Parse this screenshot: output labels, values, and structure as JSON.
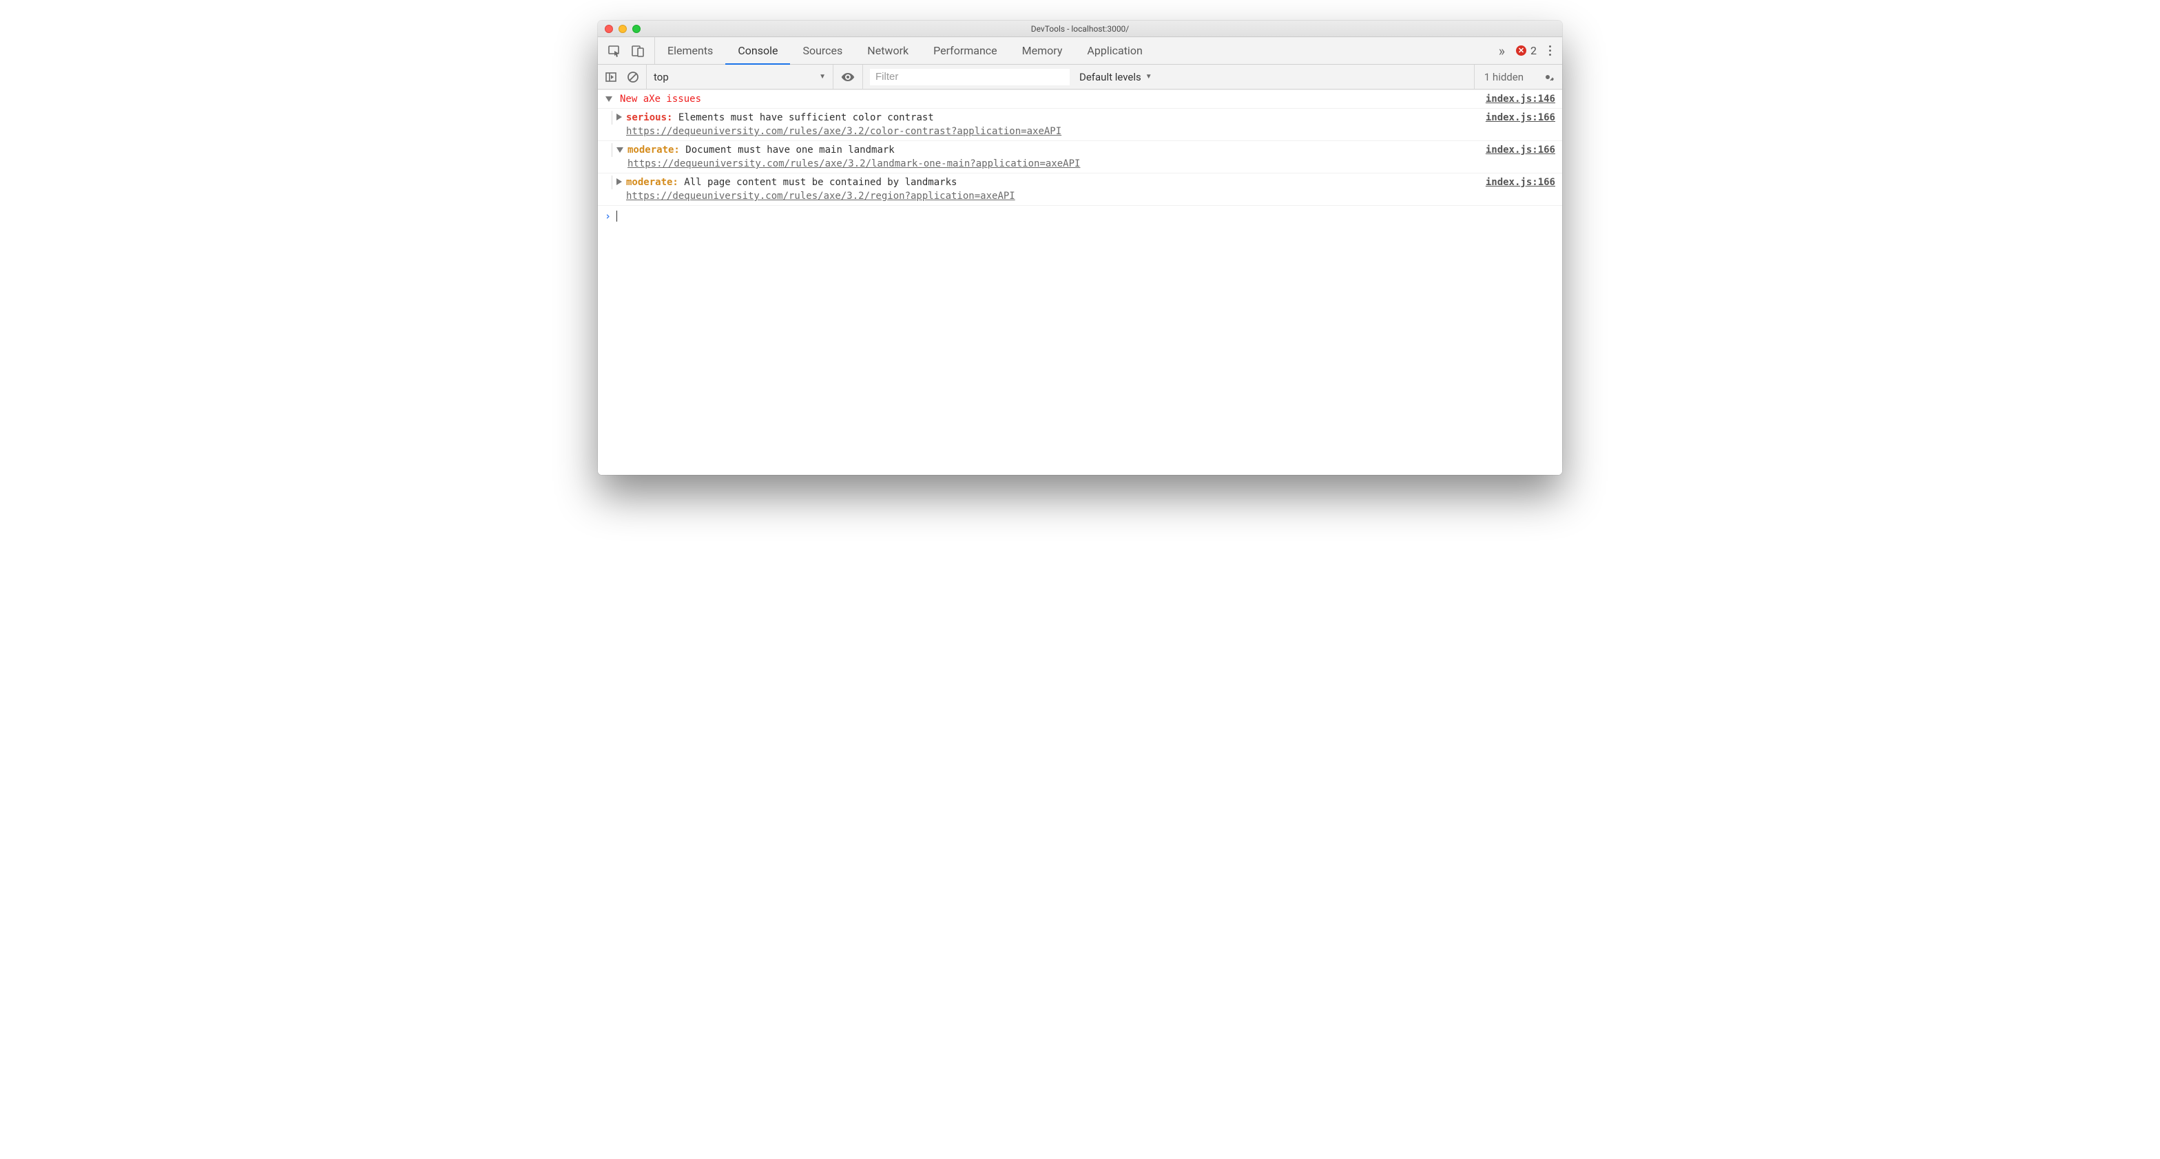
{
  "window": {
    "title": "DevTools - localhost:3000/"
  },
  "tabs": {
    "items": [
      "Elements",
      "Console",
      "Sources",
      "Network",
      "Performance",
      "Memory",
      "Application"
    ],
    "active_index": 1,
    "error_count": "2"
  },
  "console_bar": {
    "context": "top",
    "filter_placeholder": "Filter",
    "levels_label": "Default levels",
    "hidden_label": "1 hidden"
  },
  "console": {
    "group": {
      "title": "New aXe issues",
      "source": "index.js:146"
    },
    "entries": [
      {
        "expanded": false,
        "severity": "serious",
        "severity_label": "serious:",
        "message": "Elements must have sufficient color contrast",
        "url": "https://dequeuniversity.com/rules/axe/3.2/color-contrast?application=axeAPI",
        "source": "index.js:166"
      },
      {
        "expanded": true,
        "severity": "moderate",
        "severity_label": "moderate:",
        "message": "Document must have one main landmark",
        "url": "https://dequeuniversity.com/rules/axe/3.2/landmark-one-main?application=axeAPI",
        "source": "index.js:166"
      },
      {
        "expanded": false,
        "severity": "moderate",
        "severity_label": "moderate:",
        "message": "All page content must be contained by landmarks",
        "url": "https://dequeuniversity.com/rules/axe/3.2/region?application=axeAPI",
        "source": "index.js:166"
      }
    ]
  }
}
